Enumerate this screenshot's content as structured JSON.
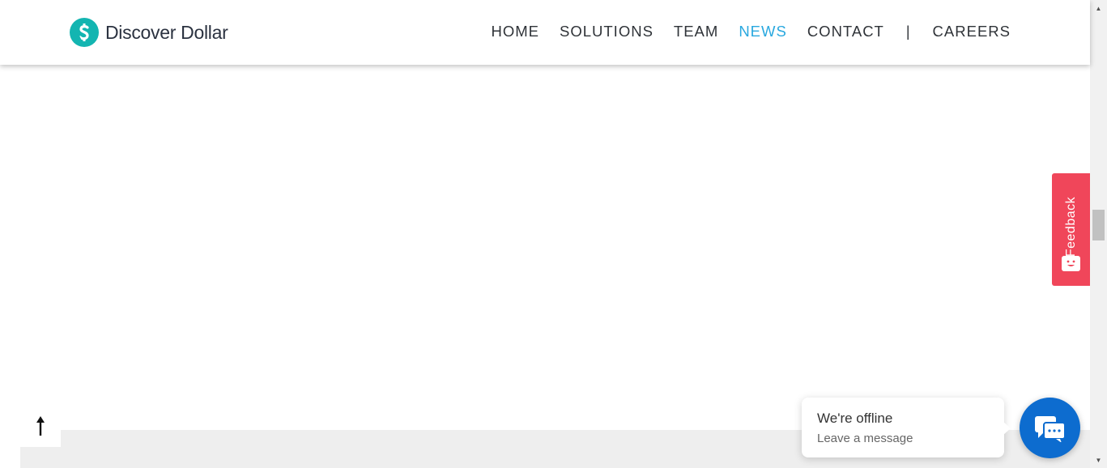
{
  "brand": {
    "name": "Discover Dollar",
    "accent": "#13b5b1"
  },
  "nav": {
    "items": [
      {
        "label": "HOME"
      },
      {
        "label": "SOLUTIONS"
      },
      {
        "label": "TEAM"
      },
      {
        "label": "NEWS",
        "active": true
      },
      {
        "label": "CONTACT"
      }
    ],
    "separator": "|",
    "careers": "CAREERS",
    "active_color": "#29a8df"
  },
  "feedback": {
    "label": "Feedback",
    "color": "#f0465a",
    "icon": "smiley-icon"
  },
  "back_to_top": {
    "icon": "arrow-up-icon"
  },
  "chat": {
    "status": "We're offline",
    "subtitle": "Leave a message",
    "icon": "chat-icon",
    "color": "#0d6ccf"
  }
}
